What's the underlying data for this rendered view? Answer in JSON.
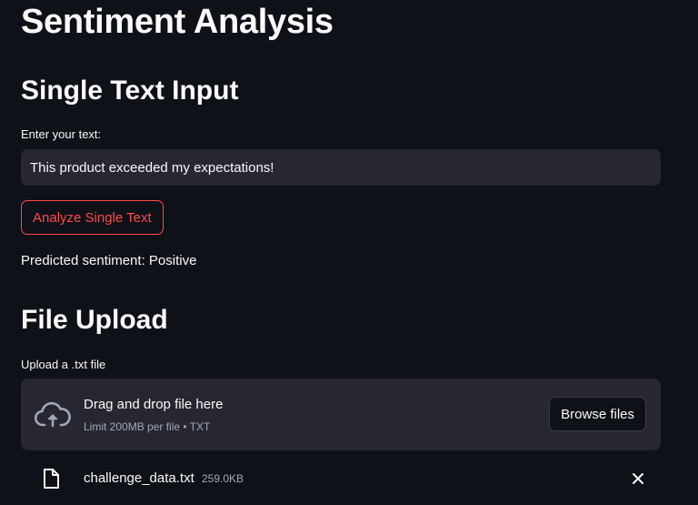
{
  "page": {
    "title": "Sentiment Analysis"
  },
  "single_text": {
    "heading": "Single Text Input",
    "input_label": "Enter your text:",
    "input_value": "This product exceeded my expectations!",
    "analyze_button": "Analyze Single Text",
    "result_text": "Predicted sentiment: Positive"
  },
  "file_upload": {
    "heading": "File Upload",
    "label": "Upload a .txt file",
    "dropzone_title": "Drag and drop file here",
    "dropzone_limit": "Limit 200MB per file • TXT",
    "browse_button": "Browse files",
    "uploaded_file": {
      "name": "challenge_data.txt",
      "size": "259.0KB"
    }
  },
  "icons": {
    "upload": "cloud-upload-icon",
    "file": "file-icon",
    "remove": "close-icon"
  },
  "colors": {
    "background": "#0e1117",
    "surface": "#262730",
    "accent": "#ff4b4b",
    "text": "#fafafa",
    "muted": "#a3a8b8"
  }
}
